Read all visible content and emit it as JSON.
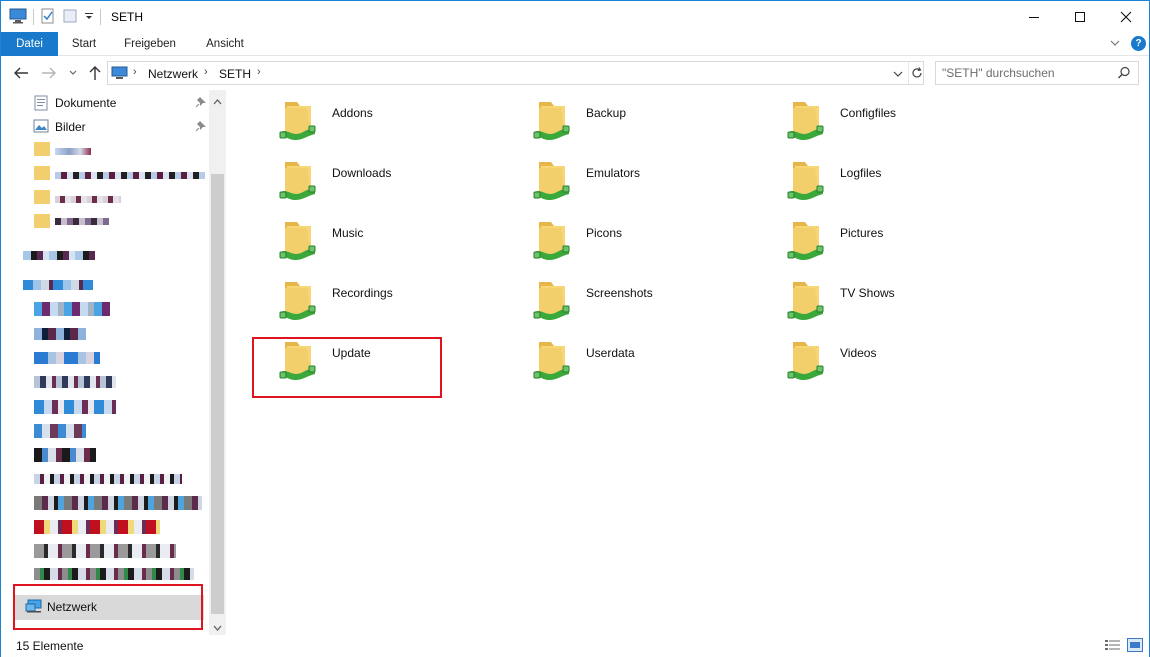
{
  "window": {
    "title": "SETH"
  },
  "ribbon": {
    "tabs": [
      {
        "label": "Datei",
        "active": true
      },
      {
        "label": "Start"
      },
      {
        "label": "Freigeben"
      },
      {
        "label": "Ansicht"
      }
    ]
  },
  "address": {
    "crumbs": [
      "Netzwerk",
      "SETH"
    ]
  },
  "search": {
    "placeholder": "\"SETH\" durchsuchen"
  },
  "navpane": {
    "quick_access": [
      {
        "label": "Dokumente",
        "icon": "documents-icon",
        "pinned": true
      },
      {
        "label": "Bilder",
        "icon": "pictures-icon",
        "pinned": true
      }
    ],
    "network": {
      "label": "Netzwerk",
      "icon": "network-icon"
    }
  },
  "folders": [
    {
      "name": "Addons"
    },
    {
      "name": "Backup"
    },
    {
      "name": "Configfiles"
    },
    {
      "name": "Downloads"
    },
    {
      "name": "Emulators"
    },
    {
      "name": "Logfiles"
    },
    {
      "name": "Music"
    },
    {
      "name": "Picons"
    },
    {
      "name": "Pictures"
    },
    {
      "name": "Recordings"
    },
    {
      "name": "Screenshots"
    },
    {
      "name": "TV Shows"
    },
    {
      "name": "Update"
    },
    {
      "name": "Userdata"
    },
    {
      "name": "Videos"
    }
  ],
  "status": {
    "count": "15 Elemente"
  },
  "colors": {
    "accent": "#1979ca",
    "highlight": "#e0141e",
    "folder": "#f2cf6b",
    "share_green": "#3aa83a"
  }
}
